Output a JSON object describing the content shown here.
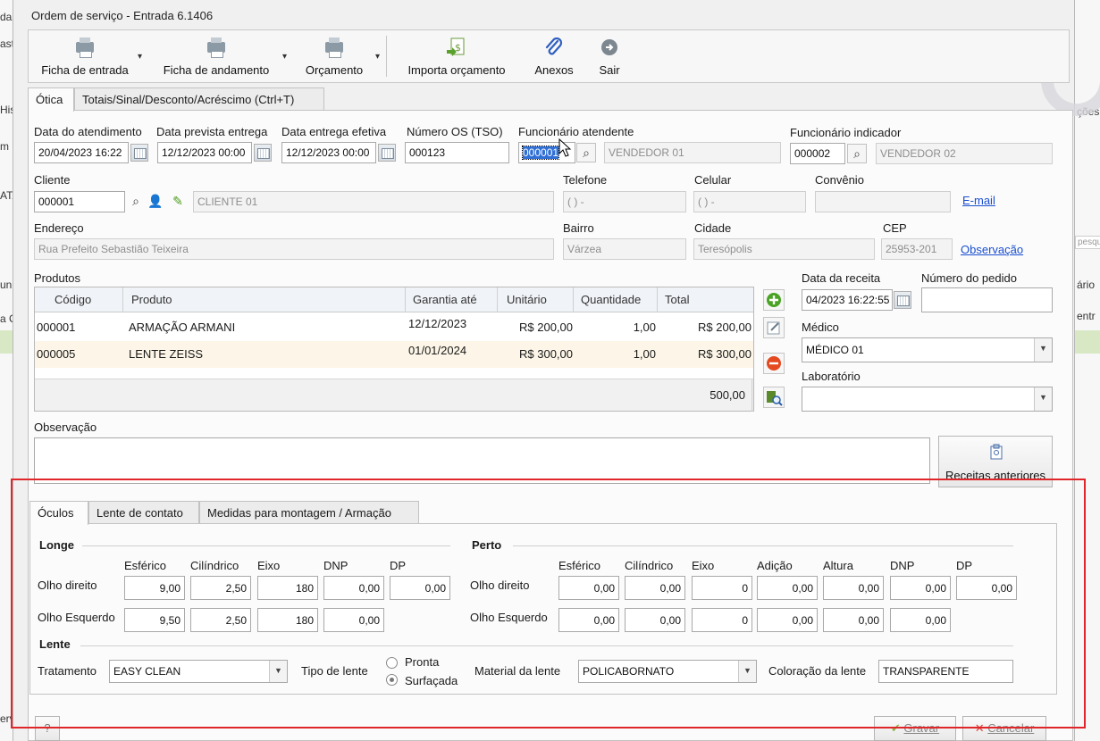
{
  "window": {
    "title": "Ordem de serviço - Entrada 6.1406"
  },
  "background_app": {
    "left_fragments": [
      "da",
      "ast",
      "His",
      "m",
      "ATA",
      "un",
      "a C",
      "erv"
    ],
    "right_fragments": [
      "ções",
      "pesqu",
      "ário",
      "entr"
    ]
  },
  "toolbar": {
    "ficha_entrada": "Ficha de entrada",
    "ficha_andamento": "Ficha de andamento",
    "orcamento": "Orçamento",
    "importa_orcamento": "Importa orçamento",
    "anexos": "Anexos",
    "sair": "Sair"
  },
  "tabs": {
    "otica": "Ótica",
    "totais": "Totais/Sinal/Desconto/Acréscimo (Ctrl+T)"
  },
  "header": {
    "data_atendimento_label": "Data do atendimento",
    "data_atendimento": "20/04/2023 16:22",
    "data_prevista_label": "Data prevista entrega",
    "data_prevista": "12/12/2023 00:00",
    "data_efetiva_label": "Data entrega efetiva",
    "data_efetiva": "12/12/2023 00:00",
    "numero_os_label": "Número OS (TSO)",
    "numero_os": "000123",
    "func_atendente_label": "Funcionário atendente",
    "func_atendente_code": "000001",
    "func_atendente_name": "VENDEDOR 01",
    "func_indicador_label": "Funcionário indicador",
    "func_indicador_code": "000002",
    "func_indicador_name": "VENDEDOR 02"
  },
  "cliente": {
    "label": "Cliente",
    "code": "000001",
    "name": "CLIENTE 01",
    "telefone_label": "Telefone",
    "telefone": "( )  -",
    "celular_label": "Celular",
    "celular": "( )  -",
    "convenio_label": "Convênio",
    "convenio": "",
    "email_link": "E-mail",
    "endereco_label": "Endereço",
    "endereco": "Rua Prefeito Sebastião Teixeira",
    "bairro_label": "Bairro",
    "bairro": "Várzea",
    "cidade_label": "Cidade",
    "cidade": "Teresópolis",
    "cep_label": "CEP",
    "cep": "25953-201",
    "observacao_link": "Observação"
  },
  "produtos": {
    "label": "Produtos",
    "columns": [
      "Código",
      "Produto",
      "Garantia até",
      "Unitário",
      "Quantidade",
      "Total"
    ],
    "rows": [
      {
        "codigo": "000001",
        "produto": "ARMAÇÃO ARMANI",
        "garantia": "12/12/2023",
        "unitario": "R$ 200,00",
        "quantidade": "1,00",
        "total": "R$ 200,00"
      },
      {
        "codigo": "000005",
        "produto": "LENTE ZEISS",
        "garantia": "01/01/2024",
        "unitario": "R$ 300,00",
        "quantidade": "1,00",
        "total": "R$ 300,00"
      }
    ],
    "footer_total": "500,00"
  },
  "receita": {
    "data_label": "Data da receita",
    "data": "04/2023 16:22:55",
    "pedido_label": "Número do pedido",
    "pedido": "",
    "medico_label": "Médico",
    "medico": "MÉDICO 01",
    "laboratorio_label": "Laboratório",
    "laboratorio": ""
  },
  "observacao": {
    "label": "Observação",
    "value": ""
  },
  "receitas_anteriores": "Receitas anteriores",
  "lower_tabs": {
    "oculos": "Óculos",
    "lente_contato": "Lente de contato",
    "medidas": "Medidas para montagem / Armação"
  },
  "longe": {
    "title": "Longe",
    "headers": [
      "Esférico",
      "Cilíndrico",
      "Eixo",
      "DNP",
      "DP"
    ],
    "od_label": "Olho direito",
    "od": [
      "9,00",
      "2,50",
      "180",
      "0,00",
      "0,00"
    ],
    "oe_label": "Olho Esquerdo",
    "oe": [
      "9,50",
      "2,50",
      "180",
      "0,00"
    ]
  },
  "perto": {
    "title": "Perto",
    "headers": [
      "Esférico",
      "Cilíndrico",
      "Eixo",
      "Adição",
      "Altura",
      "DNP",
      "DP"
    ],
    "od_label": "Olho direito",
    "od": [
      "0,00",
      "0,00",
      "0",
      "0,00",
      "0,00",
      "0,00",
      "0,00"
    ],
    "oe_label": "Olho Esquerdo",
    "oe": [
      "0,00",
      "0,00",
      "0",
      "0,00",
      "0,00",
      "0,00"
    ]
  },
  "lente": {
    "title": "Lente",
    "tratamento_label": "Tratamento",
    "tratamento": "EASY CLEAN",
    "tipo_label": "Tipo de lente",
    "tipo_pronta": "Pronta",
    "tipo_surfacada": "Surfaçada",
    "material_label": "Material da lente",
    "material": "POLICABORNATO",
    "coloracao_label": "Coloração da lente",
    "coloracao": "TRANSPARENTE"
  },
  "footer": {
    "help": "?",
    "gravar": "Gravar",
    "cancelar": "Cancelar"
  }
}
